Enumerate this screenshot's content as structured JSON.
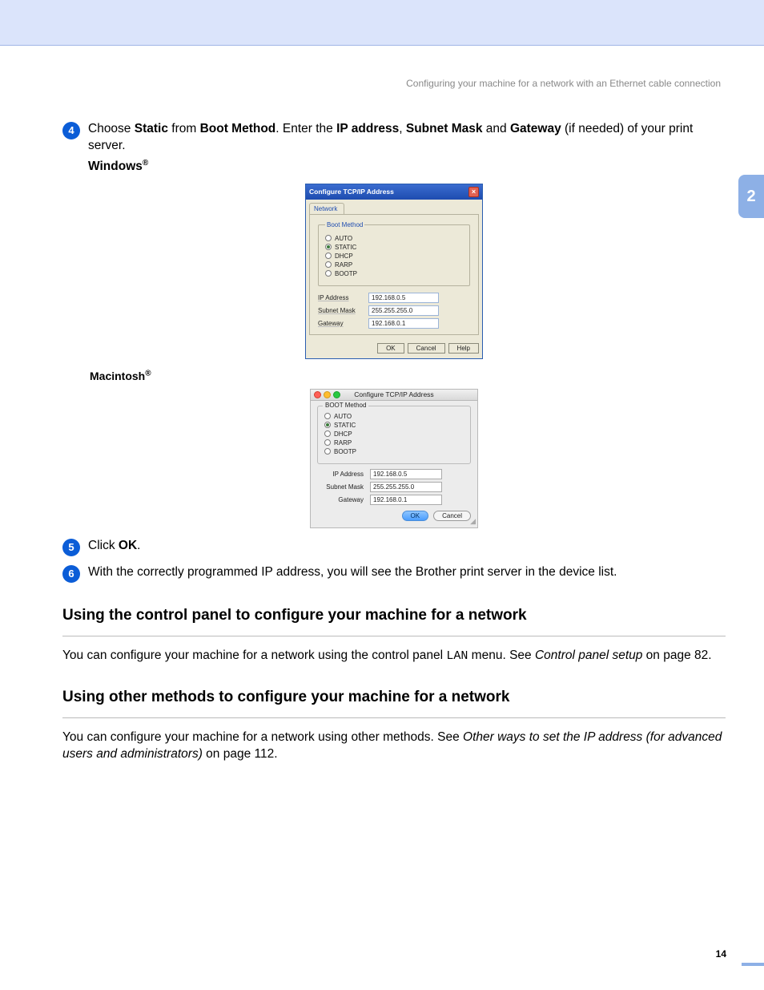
{
  "header_title": "Configuring your machine for a network with an Ethernet cable connection",
  "chapter_tab": "2",
  "page_number": "14",
  "steps": {
    "s4_num": "4",
    "s4_pre": "Choose ",
    "s4_b1": "Static",
    "s4_mid1": " from ",
    "s4_b2": "Boot Method",
    "s4_mid2": ". Enter the ",
    "s4_b3": "IP address",
    "s4_mid3": ", ",
    "s4_b4": "Subnet Mask",
    "s4_mid4": " and ",
    "s4_b5": "Gateway",
    "s4_post": " (if needed) of your print server.",
    "windows_label": "Windows",
    "reg": "®",
    "mac_label": "Macintosh",
    "s5_num": "5",
    "s5_pre": "Click ",
    "s5_b1": "OK",
    "s5_post": ".",
    "s6_num": "6",
    "s6_text": "With the correctly programmed IP address, you will see the Brother print server in the device list."
  },
  "win": {
    "title": "Configure TCP/IP Address",
    "tab": "Network",
    "boot_legend": "Boot Method",
    "opts": {
      "auto": "AUTO",
      "static": "STATIC",
      "dhcp": "DHCP",
      "rarp": "RARP",
      "bootp": "BOOTP"
    },
    "ip_label": "IP Address",
    "ip_val": "192.168.0.5",
    "mask_label": "Subnet Mask",
    "mask_val": "255.255.255.0",
    "gw_label": "Gateway",
    "gw_val": "192.168.0.1",
    "ok": "OK",
    "cancel": "Cancel",
    "help": "Help"
  },
  "mac": {
    "title": "Configure TCP/IP Address",
    "boot_legend": "BOOT Method",
    "opts": {
      "auto": "AUTO",
      "static": "STATIC",
      "dhcp": "DHCP",
      "rarp": "RARP",
      "bootp": "BOOTP"
    },
    "ip_label": "IP Address",
    "ip_val": "192.168.0.5",
    "mask_label": "Subnet Mask",
    "mask_val": "255.255.255.0",
    "gw_label": "Gateway",
    "gw_val": "192.168.0.1",
    "ok": "OK",
    "cancel": "Cancel"
  },
  "section1": {
    "heading": "Using the control panel to configure your machine for a network",
    "p_pre": "You can configure your machine for a network using the control panel ",
    "mono": "LAN",
    "p_mid": " menu. See ",
    "italic": "Control panel setup",
    "p_post": " on page 82."
  },
  "section2": {
    "heading": "Using other methods to configure your machine for a network",
    "p_pre": "You can configure your machine for a network using other methods. See ",
    "italic": "Other ways to set the IP address (for advanced users and administrators)",
    "p_post": " on page 112."
  }
}
